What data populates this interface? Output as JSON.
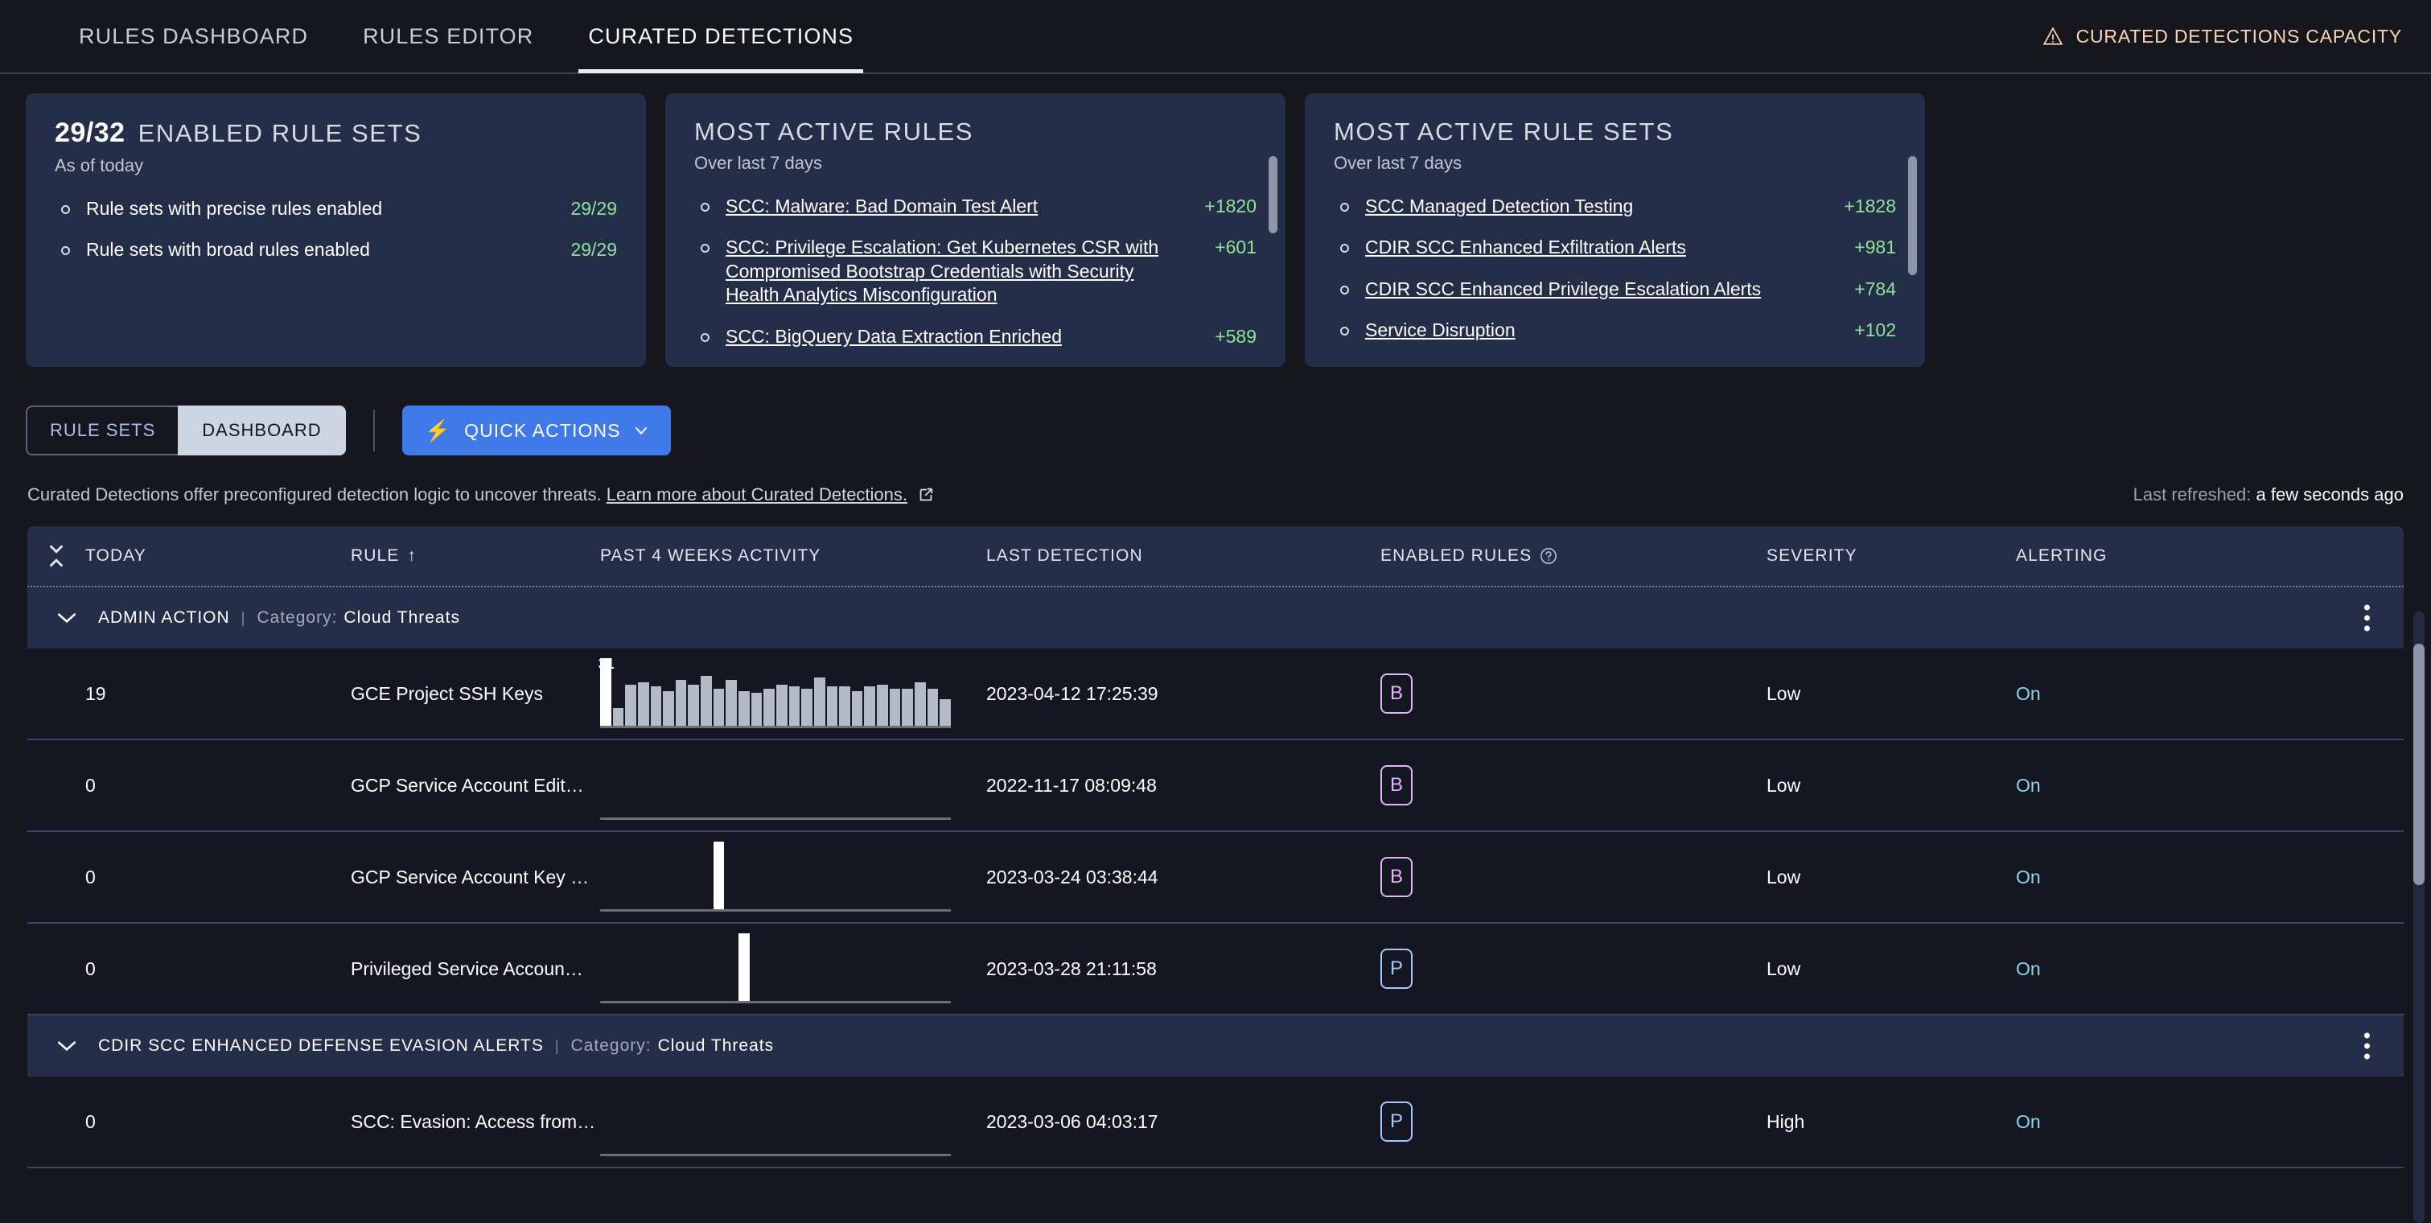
{
  "header": {
    "tabs": [
      {
        "label": "RULES DASHBOARD",
        "active": false
      },
      {
        "label": "RULES EDITOR",
        "active": false
      },
      {
        "label": "CURATED DETECTIONS",
        "active": true
      }
    ],
    "capacity_label": "CURATED DETECTIONS CAPACITY"
  },
  "cards": [
    {
      "number": "29/32",
      "title": "ENABLED RULE SETS",
      "subtitle": "As of today",
      "has_scrollbar": false,
      "items": [
        {
          "label": "Rule sets with precise rules enabled",
          "value": "29/29",
          "link": false
        },
        {
          "label": "Rule sets with broad rules enabled",
          "value": "29/29",
          "link": false
        }
      ]
    },
    {
      "number": "",
      "title": "MOST ACTIVE RULES",
      "subtitle": "Over last 7 days",
      "has_scrollbar": true,
      "items": [
        {
          "label": "SCC: Malware: Bad Domain Test Alert",
          "value": "+1820",
          "link": true
        },
        {
          "label": "SCC: Privilege Escalation: Get Kubernetes CSR with Compromised Bootstrap Credentials with Security Health Analytics Misconfiguration",
          "value": "+601",
          "link": true
        },
        {
          "label": "SCC: BigQuery Data Extraction Enriched",
          "value": "+589",
          "link": true
        }
      ]
    },
    {
      "number": "",
      "title": "MOST ACTIVE RULE SETS",
      "subtitle": "Over last 7 days",
      "has_scrollbar": true,
      "items": [
        {
          "label": "SCC Managed Detection Testing",
          "value": "+1828",
          "link": true
        },
        {
          "label": "CDIR SCC Enhanced Exfiltration Alerts",
          "value": "+981",
          "link": true
        },
        {
          "label": "CDIR SCC Enhanced Privilege Escalation Alerts",
          "value": "+784",
          "link": true
        },
        {
          "label": "Service Disruption",
          "value": "+102",
          "link": true
        }
      ]
    }
  ],
  "toolbar": {
    "seg_rule_sets": "RULE SETS",
    "seg_dashboard": "DASHBOARD",
    "quick_actions": "QUICK ACTIONS"
  },
  "info": {
    "text": "Curated Detections offer preconfigured detection logic to uncover threats.",
    "link": "Learn more about Curated Detections.",
    "refresh_label": "Last refreshed:",
    "refresh_value": "a few seconds ago"
  },
  "table": {
    "columns": {
      "today": "TODAY",
      "rule": "RULE",
      "rule_sort": "↑",
      "activity": "PAST 4 WEEKS ACTIVITY",
      "last_detection": "LAST DETECTION",
      "enabled_rules": "ENABLED RULES",
      "severity": "SEVERITY",
      "alerting": "ALERTING"
    },
    "category_label": "Category:",
    "groups": [
      {
        "name": "ADMIN ACTION",
        "category": "Cloud Threats",
        "rows": [
          {
            "today": "19",
            "rule": "GCE Project SSH Keys",
            "last_detection": "2023-04-12 17:25:39",
            "badge": "B",
            "badge_type": "broad",
            "severity": "Low",
            "alerting": "On",
            "spark_label": "31",
            "spark_label_index": 0,
            "spark": [
              31,
              8,
              19,
              20,
              18,
              16,
              21,
              19,
              23,
              17,
              21,
              16,
              15,
              17,
              19,
              18,
              17,
              22,
              18,
              18,
              16,
              18,
              19,
              17,
              17,
              20,
              17,
              12
            ]
          },
          {
            "today": "0",
            "rule": "GCP Service Account Edit…",
            "last_detection": "2022-11-17 08:09:48",
            "badge": "B",
            "badge_type": "broad",
            "severity": "Low",
            "alerting": "On",
            "spark_label": "",
            "spark_label_index": -1,
            "spark": [
              0,
              0,
              0,
              0,
              0,
              0,
              0,
              0,
              0,
              0,
              0,
              0,
              0,
              0,
              0,
              0,
              0,
              0,
              0,
              0,
              0,
              0,
              0,
              0,
              0,
              0,
              0,
              0
            ]
          },
          {
            "today": "0",
            "rule": "GCP Service Account Key …",
            "last_detection": "2023-03-24 03:38:44",
            "badge": "B",
            "badge_type": "broad",
            "severity": "Low",
            "alerting": "On",
            "spark_label": "2",
            "spark_label_index": 9,
            "spark": [
              0,
              0,
              0,
              0,
              0,
              0,
              0,
              0,
              0,
              2,
              0,
              0,
              0,
              0,
              0,
              0,
              0,
              0,
              0,
              0,
              0,
              0,
              0,
              0,
              0,
              0,
              0,
              0
            ]
          },
          {
            "today": "0",
            "rule": "Privileged Service Accoun…",
            "last_detection": "2023-03-28 21:11:58",
            "badge": "P",
            "badge_type": "precise",
            "severity": "Low",
            "alerting": "On",
            "spark_label": "1",
            "spark_label_index": 11,
            "spark": [
              0,
              0,
              0,
              0,
              0,
              0,
              0,
              0,
              0,
              0,
              0,
              1,
              0,
              0,
              0,
              0,
              0,
              0,
              0,
              0,
              0,
              0,
              0,
              0,
              0,
              0,
              0,
              0
            ]
          }
        ]
      },
      {
        "name": "CDIR SCC ENHANCED DEFENSE EVASION ALERTS",
        "category": "Cloud Threats",
        "rows": [
          {
            "today": "0",
            "rule": "SCC: Evasion: Access from…",
            "last_detection": "2023-03-06 04:03:17",
            "badge": "P",
            "badge_type": "precise",
            "severity": "High",
            "alerting": "On",
            "spark_label": "",
            "spark_label_index": -1,
            "spark": [
              0,
              0,
              0,
              0,
              0,
              0,
              0,
              0,
              0,
              0,
              0,
              0,
              0,
              0,
              0,
              0,
              0,
              0,
              0,
              0,
              0,
              0,
              0,
              0,
              0,
              0,
              0,
              0
            ]
          }
        ]
      }
    ]
  },
  "colors": {
    "accent_blue": "#3f7ae8",
    "green": "#8fe39a",
    "warn": "#fad7b2",
    "badge_broad": "#e0b6f5",
    "badge_precise": "#a8c7fa",
    "alerting": "#8ed5e8"
  }
}
